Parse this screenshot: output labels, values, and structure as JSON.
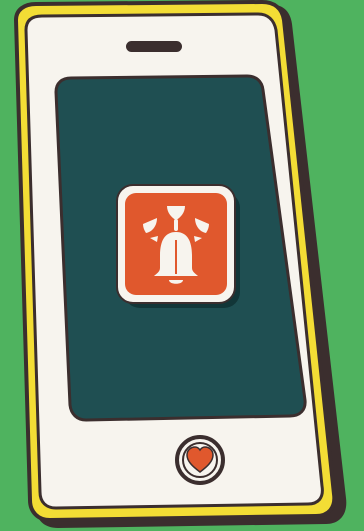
{
  "colors": {
    "background": "#4FB35F",
    "phone_outline": "#3B2E2E",
    "phone_yellow_trim": "#F3DD35",
    "phone_body": "#F7F4EE",
    "screen": "#1F4F52",
    "app_icon_background": "#E0582D",
    "app_icon_border": "#F7F4EE",
    "bell_color": "#F7F4EE",
    "home_button_heart": "#E0582D"
  },
  "icons": {
    "app_icon": "notification-bell-icon",
    "home_button": "heart-icon"
  }
}
